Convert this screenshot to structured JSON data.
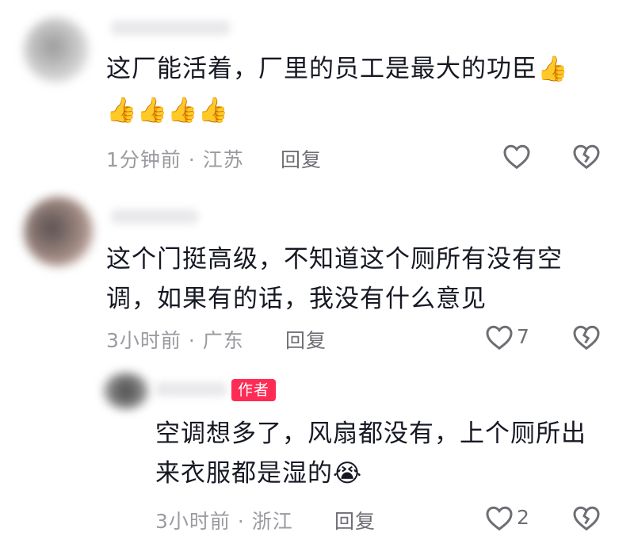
{
  "comments": [
    {
      "text_lines": [
        "这厂能活着，厂里的员工是最大的功臣👍"
      ],
      "emoji_line": "👍👍👍👍",
      "time": "1分钟前",
      "location": "江苏",
      "reply_label": "回复",
      "likes": ""
    },
    {
      "text_lines": [
        "这个门挺高级，不知道这个厕所有没有空",
        "调，如果有的话，我没有什么意见"
      ],
      "time": "3小时前",
      "location": "广东",
      "reply_label": "回复",
      "likes": "7"
    },
    {
      "is_reply": true,
      "author_badge": "作者",
      "text_lines": [
        "空调想多了，风扇都没有，上个厕所出",
        "来衣服都是湿的😭"
      ],
      "time": "3小时前",
      "location": "浙江",
      "reply_label": "回复",
      "likes": "2"
    }
  ],
  "separator": "·",
  "icons": {
    "like": "heart-outline-icon",
    "dislike": "broken-heart-icon"
  },
  "colors": {
    "badge": "#fe2c55",
    "meta": "#9a9aa0",
    "text": "#161823"
  }
}
